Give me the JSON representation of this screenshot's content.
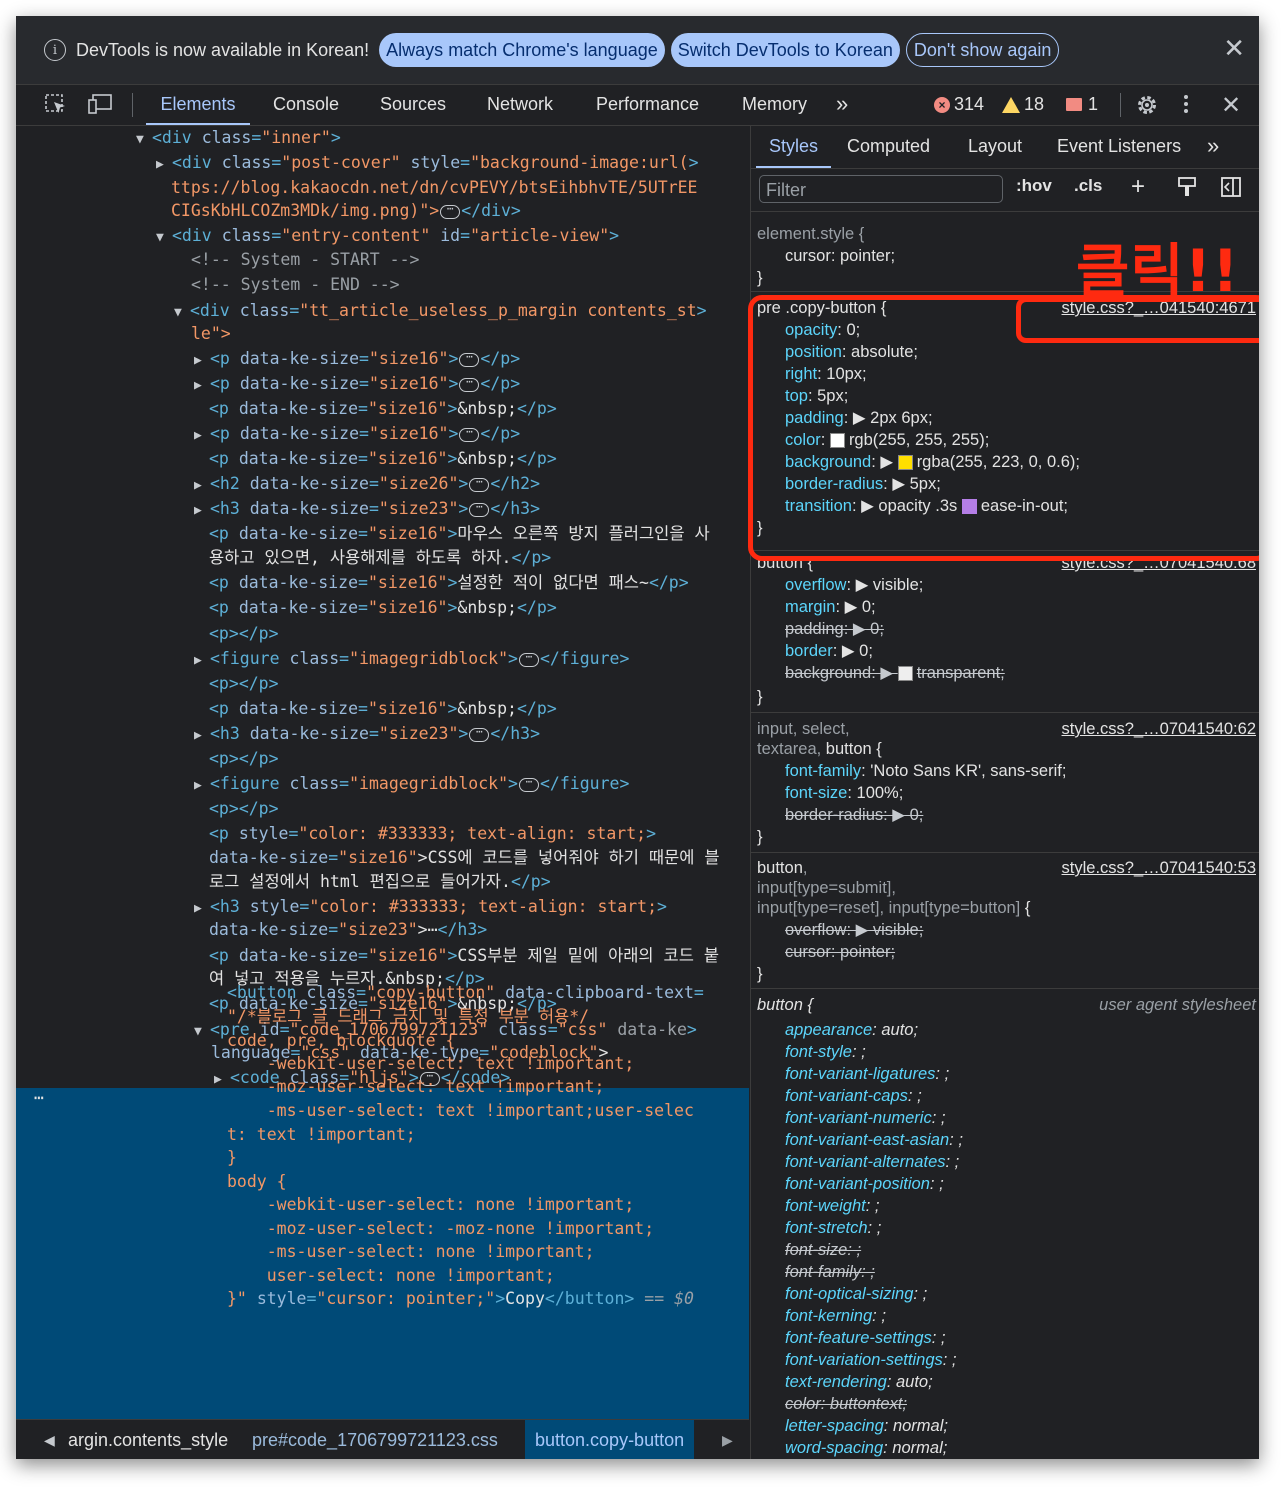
{
  "infobar": {
    "message": "DevTools is now available in Korean!",
    "btn_match": "Always match Chrome's language",
    "btn_switch": "Switch DevTools to Korean",
    "btn_dont_show": "Don't show again",
    "close": "✕"
  },
  "toolbar": {
    "tabs": [
      "Elements",
      "Console",
      "Sources",
      "Network",
      "Performance",
      "Memory"
    ],
    "more": "»",
    "errors": "314",
    "warnings": "18",
    "issues": "1"
  },
  "dom": {
    "lines": [
      "▼<div class=\"inner\">",
      "▶<div class=\"post-cover\" style=\"background-image:url(h",
      "ttps://blog.kakaocdn.net/dn/cvPEVY/btsEihbhvTE/5UTrEE",
      "CIGsKbHLCOZm3MDk/img.png)\">⋯</div>",
      "▼<div class=\"entry-content\" id=\"article-view\">",
      "<!-- System - START -->",
      "<!-- System - END -->",
      "▼<div class=\"tt_article_useless_p_margin contents_sty",
      "le\">",
      "▶<p data-ke-size=\"size16\">⋯</p>",
      "▶<p data-ke-size=\"size16\">⋯</p>",
      "<p data-ke-size=\"size16\">&nbsp;</p>",
      "▶<p data-ke-size=\"size16\">⋯</p>",
      "<p data-ke-size=\"size16\">&nbsp;</p>",
      "▶<h2 data-ke-size=\"size26\">⋯</h2>",
      "▶<h3 data-ke-size=\"size23\">⋯</h3>",
      "<p data-ke-size=\"size16\">마우스 오른쪽 방지 플러그인을 사",
      "용하고 있으면, 사용해제를 하도록 하자.</p>",
      "<p data-ke-size=\"size16\">설정한 적이 없다면 패스~</p>",
      "<p data-ke-size=\"size16\">&nbsp;</p>",
      "<p></p>",
      "▶<figure class=\"imagegridblock\">⋯</figure>",
      "<p></p>",
      "<p data-ke-size=\"size16\">&nbsp;</p>",
      "▶<h3 data-ke-size=\"size23\">⋯</h3>",
      "<p></p>",
      "▶<figure class=\"imagegridblock\">⋯</figure>",
      "<p></p>",
      "<p style=\"color: #333333; text-align: start;\"",
      "data-ke-size=\"size16\">CSS에 코드를 넣어줘야 하기 때문에 블",
      "로그 설정에서 html 편집으로 들어가자.</p>",
      "▶<h3 style=\"color: #333333; text-align: start;\"",
      "data-ke-size=\"size23\">⋯</h3>",
      "<p data-ke-size=\"size16\">CSS부분 제일 밑에 아래의 코드 붙",
      "여 넣고 적용을 누르자.&nbsp;</p>",
      "<p data-ke-size=\"size16\">&nbsp;</p>",
      "▼<pre id=\"code_1706799721123\" class=\"css\" data-ke-",
      "language=\"css\" data-ke-type=\"codeblock\">",
      "▶<code class=\"hljs\">⋯</code>"
    ],
    "selected_lines": [
      "<button class=\"copy-button\" data-clipboard-text=",
      "\"/*블로그 글 드래그 금지 및 특정 부분 허용*/",
      "code, pre, blockquote {",
      "    -webkit-user-select: text !important;",
      "    -moz-user-select: text !important;",
      "    -ms-user-select: text !important;user-selec",
      "t: text !important;",
      "}",
      "body {",
      "    -webkit-user-select: none !important;",
      "    -moz-user-select: -moz-none !important;",
      "    -ms-user-select: none !important;",
      "    user-select: none !important;",
      "}\" style=\"cursor: pointer;\">Copy</button> == $0"
    ],
    "selected_dots": "⋯"
  },
  "breadcrumb": {
    "items": [
      "argin.contents_style",
      "pre#code_1706799721123.css",
      "button.copy-button"
    ]
  },
  "styles": {
    "tabs": [
      "Styles",
      "Computed",
      "Layout",
      "Event Listeners"
    ],
    "more": "»",
    "filter_placeholder": "Filter",
    "hov": ":hov",
    "cls": ".cls",
    "element_style_sel": "element.style {",
    "element_style_prop": "cursor: pointer;",
    "close_brace": "}",
    "rule1": {
      "selector": "pre .copy-button {",
      "source": "style.css?_…041540:4671",
      "props": [
        [
          "opacity",
          "0;"
        ],
        [
          "position",
          "absolute;"
        ],
        [
          "right",
          "10px;"
        ],
        [
          "top",
          "5px;"
        ],
        [
          "padding",
          "▶ 2px 6px;"
        ],
        [
          "color",
          "rgb(255, 255, 255);"
        ],
        [
          "background",
          "rgba(255, 223, 0, 0.6);"
        ],
        [
          "border-radius",
          "▶ 5px;"
        ],
        [
          "transition",
          "▶ opacity .3s"
        ]
      ],
      "transition_tail": "ease-in-out;"
    },
    "rule2": {
      "selector": "button {",
      "source": "style.css?_…07041540:68",
      "props": [
        [
          "overflow",
          "▶ visible;"
        ],
        [
          "margin",
          "▶ 0;"
        ],
        [
          "padding",
          "▶ 0;"
        ],
        [
          "border",
          "▶ 0;"
        ],
        [
          "background",
          "transparent;"
        ]
      ]
    },
    "rule3": {
      "selector1": "input, select,",
      "selector2": "textarea, button {",
      "source": "style.css?_…07041540:62",
      "props": [
        [
          "font-family",
          "'Noto Sans KR', sans-serif;"
        ],
        [
          "font-size",
          "100%;"
        ],
        [
          "border-radius",
          "▶ 0;"
        ]
      ]
    },
    "rule4": {
      "selector1": "button,",
      "selector2": "input[type=submit],",
      "selector3": "input[type=reset], input[type=button] {",
      "source": "style.css?_…07041540:53",
      "props": [
        [
          "overflow",
          "▶ visible;"
        ],
        [
          "cursor",
          "pointer;"
        ]
      ]
    },
    "ua": {
      "selector": "button {",
      "source": "user agent stylesheet",
      "props": [
        [
          "appearance",
          "auto;"
        ],
        [
          "font-style",
          ";"
        ],
        [
          "font-variant-ligatures",
          ";"
        ],
        [
          "font-variant-caps",
          ";"
        ],
        [
          "font-variant-numeric",
          ";"
        ],
        [
          "font-variant-east-asian",
          ";"
        ],
        [
          "font-variant-alternates",
          ";"
        ],
        [
          "font-variant-position",
          ";"
        ],
        [
          "font-weight",
          ";"
        ],
        [
          "font-stretch",
          ";"
        ],
        [
          "font-size",
          ";"
        ],
        [
          "font-family",
          ";"
        ],
        [
          "font-optical-sizing",
          ";"
        ],
        [
          "font-kerning",
          ";"
        ],
        [
          "font-feature-settings",
          ";"
        ],
        [
          "font-variation-settings",
          ";"
        ],
        [
          "text-rendering",
          "auto;"
        ],
        [
          "color",
          "buttontext;"
        ],
        [
          "letter-spacing",
          "normal;"
        ],
        [
          "word-spacing",
          "normal;"
        ]
      ]
    }
  },
  "annotation": "클릭!!",
  "colors": {
    "accent": "#a8c7fa",
    "highlight": "#ff2a10",
    "swatch_white": "#ffffff",
    "swatch_yellow": "#ffdf00"
  }
}
